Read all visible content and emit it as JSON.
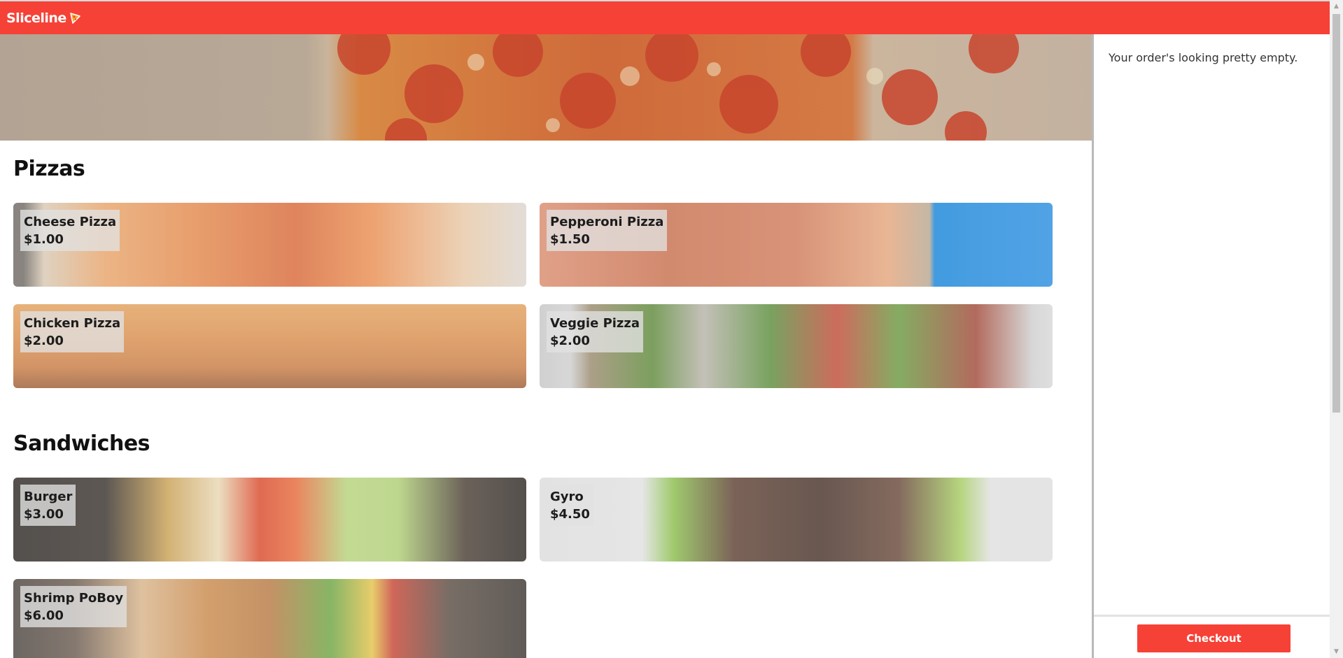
{
  "header": {
    "app_name": "Sliceline",
    "logo_icon": "pizza-slice-icon",
    "brand_color": "#f64137"
  },
  "menu": {
    "sections": [
      {
        "title": "Pizzas",
        "items": [
          {
            "name": "Cheese Pizza",
            "price": "$1.00"
          },
          {
            "name": "Pepperoni Pizza",
            "price": "$1.50"
          },
          {
            "name": "Chicken Pizza",
            "price": "$2.00"
          },
          {
            "name": "Veggie Pizza",
            "price": "$2.00"
          }
        ]
      },
      {
        "title": "Sandwiches",
        "items": [
          {
            "name": "Burger",
            "price": "$3.00"
          },
          {
            "name": "Gyro",
            "price": "$4.50"
          },
          {
            "name": "Shrimp PoBoy",
            "price": "$6.00"
          }
        ]
      }
    ]
  },
  "order": {
    "empty_message": "Your order's looking pretty empty.",
    "checkout_label": "Checkout"
  }
}
